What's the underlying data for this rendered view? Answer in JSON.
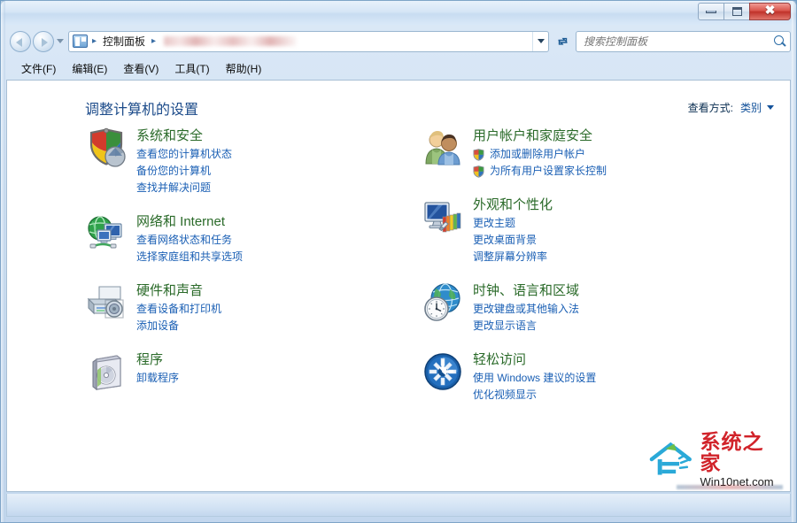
{
  "window": {
    "title": "",
    "controls": {
      "minimize": "–",
      "maximize": "☐",
      "close": "✕"
    }
  },
  "nav": {
    "back_tooltip": "后退",
    "forward_tooltip": "前进",
    "recent_pages": "最近的页面",
    "breadcrumb": [
      "控制面板"
    ],
    "breadcrumb_separator": "▸",
    "redacted_path": "",
    "refresh_label": "↻",
    "search": {
      "placeholder": "搜索控制面板",
      "value": ""
    }
  },
  "menubar": {
    "items": [
      {
        "label": "文件(F)"
      },
      {
        "label": "编辑(E)"
      },
      {
        "label": "查看(V)"
      },
      {
        "label": "工具(T)"
      },
      {
        "label": "帮助(H)"
      }
    ]
  },
  "page": {
    "heading": "调整计算机的设置",
    "view_by": {
      "label": "查看方式:",
      "value": "类别"
    }
  },
  "categories": {
    "left": [
      {
        "icon": "shield-pie-icon",
        "title": "系统和安全",
        "links": [
          {
            "text": "查看您的计算机状态",
            "shield": false
          },
          {
            "text": "备份您的计算机",
            "shield": false
          },
          {
            "text": "查找并解决问题",
            "shield": false
          }
        ]
      },
      {
        "icon": "globe-monitors-icon",
        "title": "网络和 Internet",
        "links": [
          {
            "text": "查看网络状态和任务",
            "shield": false
          },
          {
            "text": "选择家庭组和共享选项",
            "shield": false
          }
        ]
      },
      {
        "icon": "printer-speaker-icon",
        "title": "硬件和声音",
        "links": [
          {
            "text": "查看设备和打印机",
            "shield": false
          },
          {
            "text": "添加设备",
            "shield": false
          }
        ]
      },
      {
        "icon": "software-box-icon",
        "title": "程序",
        "links": [
          {
            "text": "卸载程序",
            "shield": false
          }
        ]
      }
    ],
    "right": [
      {
        "icon": "two-users-icon",
        "title": "用户帐户和家庭安全",
        "links": [
          {
            "text": "添加或删除用户帐户",
            "shield": true
          },
          {
            "text": "为所有用户设置家长控制",
            "shield": true
          }
        ]
      },
      {
        "icon": "monitor-palette-icon",
        "title": "外观和个性化",
        "links": [
          {
            "text": "更改主题",
            "shield": false
          },
          {
            "text": "更改桌面背景",
            "shield": false
          },
          {
            "text": "调整屏幕分辨率",
            "shield": false
          }
        ]
      },
      {
        "icon": "clock-globe-icon",
        "title": "时钟、语言和区域",
        "links": [
          {
            "text": "更改键盘或其他输入法",
            "shield": false
          },
          {
            "text": "更改显示语言",
            "shield": false
          }
        ]
      },
      {
        "icon": "ease-of-access-icon",
        "title": "轻松访问",
        "links": [
          {
            "text": "使用 Windows 建议的设置",
            "shield": false
          },
          {
            "text": "优化视频显示",
            "shield": false
          }
        ]
      }
    ]
  },
  "watermark": {
    "cn": "系统之家",
    "en": "Win10net.com"
  },
  "colors": {
    "category_title": "#2a6a29",
    "link": "#1a5fb4",
    "heading": "#1c4b8a",
    "close_button": "#c0322a",
    "watermark_red": "#d1232a"
  }
}
